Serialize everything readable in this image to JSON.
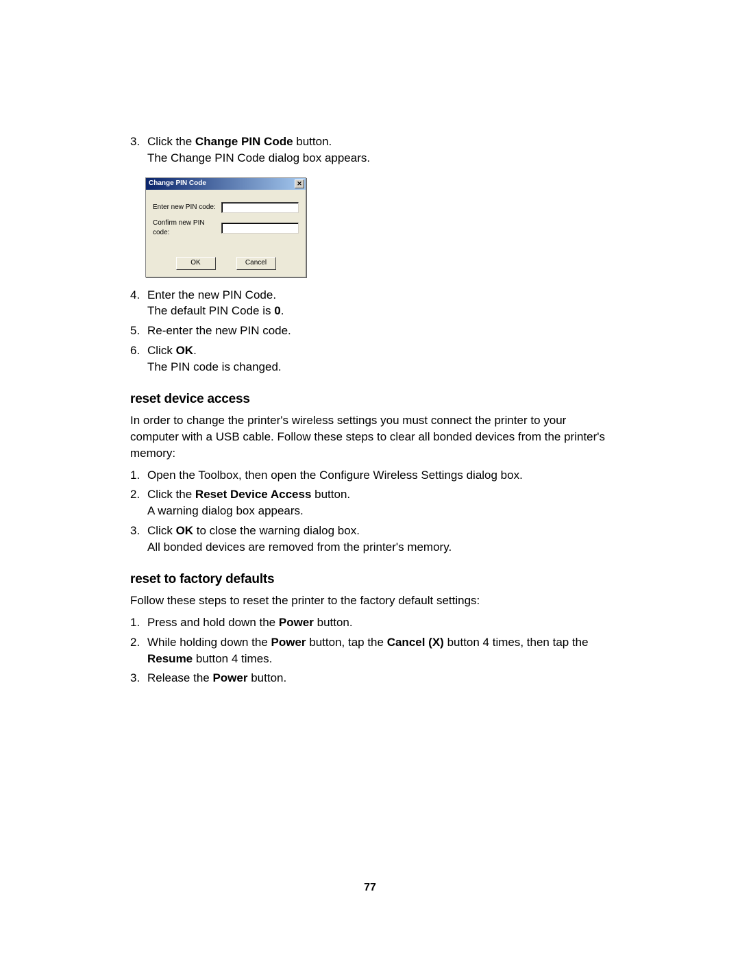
{
  "steps_pin": {
    "3": {
      "line1_pre": "Click the ",
      "line1_bold": "Change PIN Code",
      "line1_post": " button.",
      "line2": "The Change PIN Code dialog box appears."
    },
    "4": {
      "line1": "Enter the new PIN Code.",
      "line2_pre": "The default PIN Code is ",
      "line2_bold": "0",
      "line2_post": "."
    },
    "5": {
      "line1": "Re-enter the new PIN code."
    },
    "6": {
      "line1_pre": "Click ",
      "line1_bold": "OK",
      "line1_post": ".",
      "line2": "The PIN code is changed."
    }
  },
  "dialog": {
    "title": "Change PIN Code",
    "label_enter": "Enter new PIN code:",
    "label_confirm": "Confirm new PIN code:",
    "btn_ok": "OK",
    "btn_cancel": "Cancel"
  },
  "reset_access": {
    "heading": "reset device access",
    "intro": "In order to change the printer's wireless settings you must connect the printer to your computer with a USB cable. Follow these steps to clear all bonded devices from the printer's memory:",
    "1": {
      "line1": "Open the Toolbox, then open the Configure Wireless Settings dialog box."
    },
    "2": {
      "line1_pre": "Click the ",
      "line1_bold": "Reset Device Access",
      "line1_post": " button.",
      "line2": "A warning dialog box appears."
    },
    "3": {
      "line1_pre": "Click ",
      "line1_bold": "OK",
      "line1_post": " to close the warning dialog box.",
      "line2": "All bonded devices are removed from the printer's memory."
    }
  },
  "reset_factory": {
    "heading": "reset to factory defaults",
    "intro": "Follow these steps to reset the printer to the factory default settings:",
    "1": {
      "pre": "Press and hold down the ",
      "b1": "Power",
      "post": " button."
    },
    "2": {
      "p1": "While holding down the ",
      "b1": "Power",
      "p2": " button, tap the ",
      "b2": "Cancel (X)",
      "p3": " button 4 times, then tap the ",
      "b3": "Resume",
      "p4": " button 4 times."
    },
    "3": {
      "pre": "Release the ",
      "b1": "Power",
      "post": " button."
    }
  },
  "page_number": "77"
}
